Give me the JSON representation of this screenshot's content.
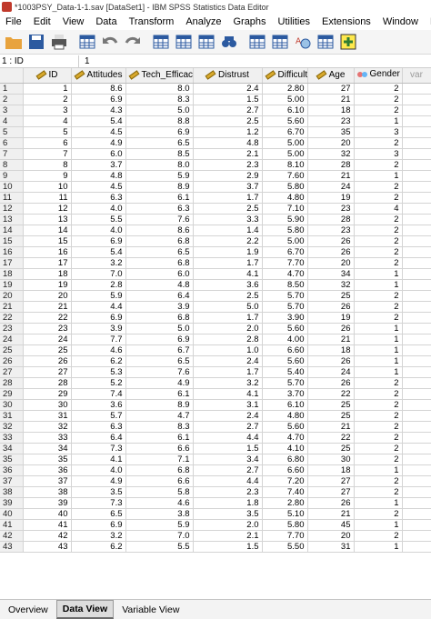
{
  "window": {
    "title": "*1003PSY_Data-1-1.sav [DataSet1] - IBM SPSS Statistics Data Editor"
  },
  "menu": [
    "File",
    "Edit",
    "View",
    "Data",
    "Transform",
    "Analyze",
    "Graphs",
    "Utilities",
    "Extensions",
    "Window",
    "Help"
  ],
  "toolbar": [
    {
      "name": "open-icon",
      "color": "#e8a33d"
    },
    {
      "name": "save-icon",
      "color": "#2c5aa0"
    },
    {
      "name": "print-icon",
      "color": "#555555"
    },
    {
      "name": "dialog-recall-icon",
      "color": "#2c5aa0"
    },
    {
      "name": "undo-icon",
      "color": "#777777"
    },
    {
      "name": "redo-icon",
      "color": "#777777"
    },
    {
      "name": "goto-case-icon",
      "color": "#2c5aa0"
    },
    {
      "name": "goto-variable-icon",
      "color": "#2c5aa0"
    },
    {
      "name": "variables-icon",
      "color": "#2c5aa0"
    },
    {
      "name": "find-icon",
      "color": "#2c5aa0"
    },
    {
      "name": "split-file-icon",
      "color": "#2c5aa0"
    },
    {
      "name": "weight-cases-icon",
      "color": "#2c5aa0"
    },
    {
      "name": "select-cases-icon",
      "color": "#c0392b"
    },
    {
      "name": "value-labels-icon",
      "color": "#2c5aa0"
    },
    {
      "name": "use-sets-icon",
      "color": "#2e7d32"
    }
  ],
  "cell_editor": {
    "reference": "1 : ID",
    "value": "1"
  },
  "columns": [
    "ID",
    "Attitudes",
    "Tech_Efficacy",
    "Distrust",
    "Difficulty",
    "Age",
    "Gender"
  ],
  "extra_column": "var",
  "rows": [
    [
      "1",
      "1",
      "8.6",
      "8.0",
      "2.4",
      "2.80",
      "27",
      "2"
    ],
    [
      "2",
      "2",
      "6.9",
      "8.3",
      "1.5",
      "5.00",
      "21",
      "2"
    ],
    [
      "3",
      "3",
      "4.3",
      "5.0",
      "2.7",
      "6.10",
      "18",
      "2"
    ],
    [
      "4",
      "4",
      "5.4",
      "8.8",
      "2.5",
      "5.60",
      "23",
      "1"
    ],
    [
      "5",
      "5",
      "4.5",
      "6.9",
      "1.2",
      "6.70",
      "35",
      "3"
    ],
    [
      "6",
      "6",
      "4.9",
      "6.5",
      "4.8",
      "5.00",
      "20",
      "2"
    ],
    [
      "7",
      "7",
      "6.0",
      "8.5",
      "2.1",
      "5.00",
      "32",
      "3"
    ],
    [
      "8",
      "8",
      "3.7",
      "8.0",
      "2.3",
      "8.10",
      "28",
      "2"
    ],
    [
      "9",
      "9",
      "4.8",
      "5.9",
      "2.9",
      "7.60",
      "21",
      "1"
    ],
    [
      "10",
      "10",
      "4.5",
      "8.9",
      "3.7",
      "5.80",
      "24",
      "2"
    ],
    [
      "11",
      "11",
      "6.3",
      "6.1",
      "1.7",
      "4.80",
      "19",
      "2"
    ],
    [
      "12",
      "12",
      "4.0",
      "6.3",
      "2.5",
      "7.10",
      "23",
      "4"
    ],
    [
      "13",
      "13",
      "5.5",
      "7.6",
      "3.3",
      "5.90",
      "28",
      "2"
    ],
    [
      "14",
      "14",
      "4.0",
      "8.6",
      "1.4",
      "5.80",
      "23",
      "2"
    ],
    [
      "15",
      "15",
      "6.9",
      "6.8",
      "2.2",
      "5.00",
      "26",
      "2"
    ],
    [
      "16",
      "16",
      "5.4",
      "6.5",
      "1.9",
      "6.70",
      "26",
      "2"
    ],
    [
      "17",
      "17",
      "3.2",
      "6.8",
      "1.7",
      "7.70",
      "20",
      "2"
    ],
    [
      "18",
      "18",
      "7.0",
      "6.0",
      "4.1",
      "4.70",
      "34",
      "1"
    ],
    [
      "19",
      "19",
      "2.8",
      "4.8",
      "3.6",
      "8.50",
      "32",
      "1"
    ],
    [
      "20",
      "20",
      "5.9",
      "6.4",
      "2.5",
      "5.70",
      "25",
      "2"
    ],
    [
      "21",
      "21",
      "4.4",
      "3.9",
      "5.0",
      "5.70",
      "26",
      "2"
    ],
    [
      "22",
      "22",
      "6.9",
      "6.8",
      "1.7",
      "3.90",
      "19",
      "2"
    ],
    [
      "23",
      "23",
      "3.9",
      "5.0",
      "2.0",
      "5.60",
      "26",
      "1"
    ],
    [
      "24",
      "24",
      "7.7",
      "6.9",
      "2.8",
      "4.00",
      "21",
      "1"
    ],
    [
      "25",
      "25",
      "4.6",
      "6.7",
      "1.0",
      "6.60",
      "18",
      "1"
    ],
    [
      "26",
      "26",
      "6.2",
      "6.5",
      "2.4",
      "5.60",
      "26",
      "1"
    ],
    [
      "27",
      "27",
      "5.3",
      "7.6",
      "1.7",
      "5.40",
      "24",
      "1"
    ],
    [
      "28",
      "28",
      "5.2",
      "4.9",
      "3.2",
      "5.70",
      "26",
      "2"
    ],
    [
      "29",
      "29",
      "7.4",
      "6.1",
      "4.1",
      "3.70",
      "22",
      "2"
    ],
    [
      "30",
      "30",
      "3.6",
      "8.9",
      "3.1",
      "6.10",
      "25",
      "2"
    ],
    [
      "31",
      "31",
      "5.7",
      "4.7",
      "2.4",
      "4.80",
      "25",
      "2"
    ],
    [
      "32",
      "32",
      "6.3",
      "8.3",
      "2.7",
      "5.60",
      "21",
      "2"
    ],
    [
      "33",
      "33",
      "6.4",
      "6.1",
      "4.4",
      "4.70",
      "22",
      "2"
    ],
    [
      "34",
      "34",
      "7.3",
      "6.6",
      "1.5",
      "4.10",
      "25",
      "2"
    ],
    [
      "35",
      "35",
      "4.1",
      "7.1",
      "3.4",
      "6.80",
      "30",
      "2"
    ],
    [
      "36",
      "36",
      "4.0",
      "6.8",
      "2.7",
      "6.60",
      "18",
      "1"
    ],
    [
      "37",
      "37",
      "4.9",
      "6.6",
      "4.4",
      "7.20",
      "27",
      "2"
    ],
    [
      "38",
      "38",
      "3.5",
      "5.8",
      "2.3",
      "7.40",
      "27",
      "2"
    ],
    [
      "39",
      "39",
      "7.3",
      "4.6",
      "1.8",
      "2.80",
      "26",
      "1"
    ],
    [
      "40",
      "40",
      "6.5",
      "3.8",
      "3.5",
      "5.10",
      "21",
      "2"
    ],
    [
      "41",
      "41",
      "6.9",
      "5.9",
      "2.0",
      "5.80",
      "45",
      "1"
    ],
    [
      "42",
      "42",
      "3.2",
      "7.0",
      "2.1",
      "7.70",
      "20",
      "2"
    ],
    [
      "43",
      "43",
      "6.2",
      "5.5",
      "1.5",
      "5.50",
      "31",
      "1"
    ]
  ],
  "tabs": [
    "Overview",
    "Data View",
    "Variable View"
  ],
  "active_tab": "Data View"
}
